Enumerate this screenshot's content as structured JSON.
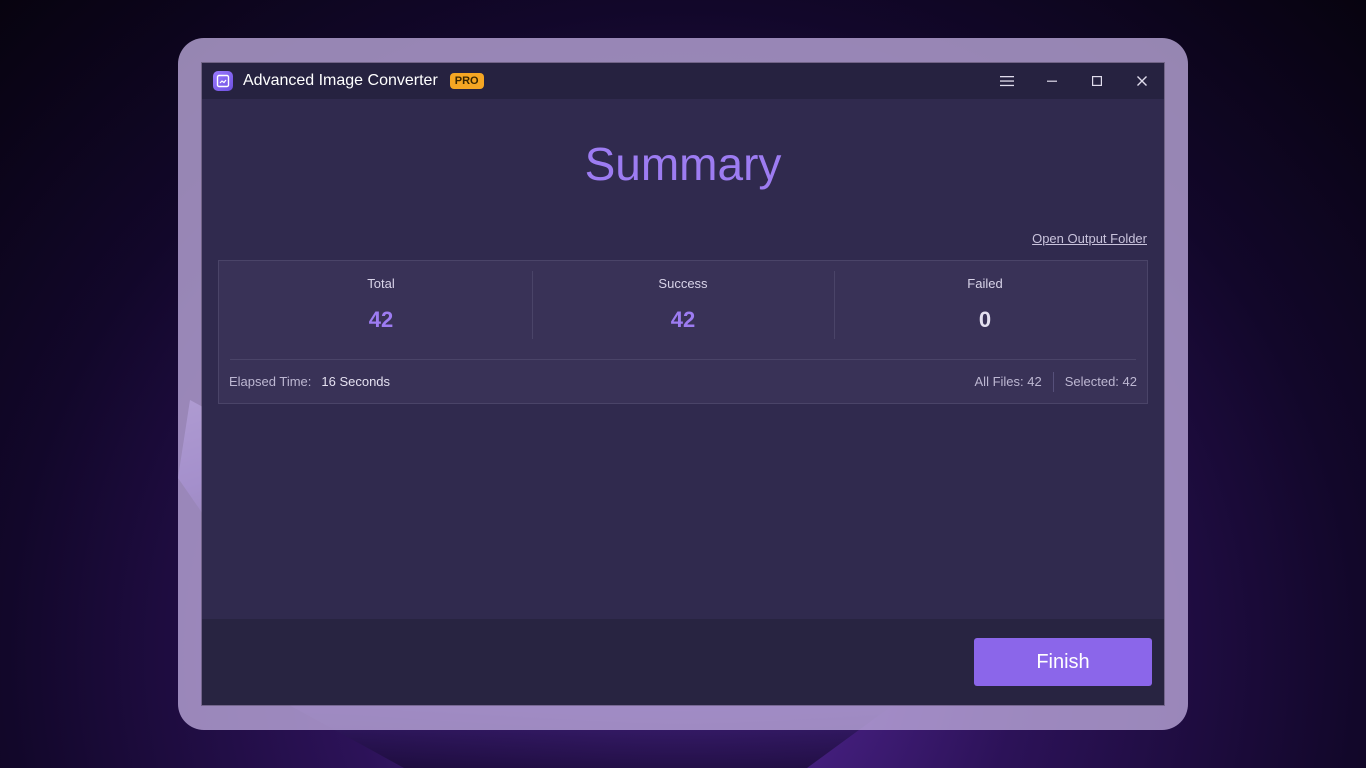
{
  "window": {
    "title": "Advanced Image Converter",
    "badge": "PRO"
  },
  "summary": {
    "heading": "Summary",
    "open_output_folder": "Open Output Folder",
    "stats": [
      {
        "label": "Total",
        "value": "42"
      },
      {
        "label": "Success",
        "value": "42"
      },
      {
        "label": "Failed",
        "value": "0"
      }
    ],
    "elapsed_label": "Elapsed Time:",
    "elapsed_value": "16 Seconds",
    "all_files": "All Files: 42",
    "selected": "Selected: 42"
  },
  "actions": {
    "finish_label": "Finish"
  },
  "colors": {
    "accent": "#9d7cf2",
    "button": "#8b66ea",
    "badge": "#f5a623",
    "window_bg": "#302a4e",
    "titlebar_bg": "#262240"
  }
}
